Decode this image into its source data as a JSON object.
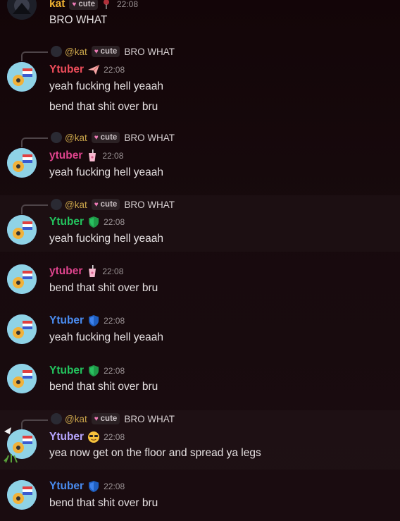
{
  "colors": {
    "kat": "#f0b232",
    "ytuber_red": "#f04d5b",
    "ytuber_pink": "#e0448e",
    "ytuber_green": "#23c45e",
    "ytuber_blue": "#4a8cf0",
    "ytuber_purple": "#b7a6ff"
  },
  "top_message": {
    "author": "kat",
    "tag": "cute",
    "time": "22:08",
    "text": "BRO WHAT"
  },
  "reply_preview": {
    "mention": "@kat",
    "tag": "cute",
    "text": "BRO WHAT"
  },
  "messages": [
    {
      "author": "Ytuber",
      "badge_icon": "paper-plane-icon",
      "time": "22:08",
      "lines": [
        "yeah fucking hell yeaah",
        "bend that shit over bru"
      ],
      "has_reply": true
    },
    {
      "author": "ytuber",
      "badge_icon": "milkshake-cup-icon",
      "time": "22:08",
      "lines": [
        "yeah fucking hell yeaah"
      ],
      "has_reply": true
    },
    {
      "author": "Ytuber",
      "badge_icon": "green-shield-icon",
      "time": "22:08",
      "lines": [
        "yeah fucking hell yeaah"
      ],
      "has_reply": true
    },
    {
      "author": "ytuber",
      "badge_icon": "milkshake-cup-icon",
      "time": "22:08",
      "lines": [
        "bend that shit over bru"
      ],
      "has_reply": false
    },
    {
      "author": "Ytuber",
      "badge_icon": "blue-shield-icon",
      "time": "22:08",
      "lines": [
        "yeah fucking hell yeaah"
      ],
      "has_reply": false
    },
    {
      "author": "Ytuber",
      "badge_icon": "green-shield-icon",
      "time": "22:08",
      "lines": [
        "bend that shit over bru"
      ],
      "has_reply": false
    },
    {
      "author": "Ytuber",
      "badge_icon": "sunglasses-emoji-icon",
      "time": "22:08",
      "lines": [
        "yea now get on the floor and spread ya legs"
      ],
      "has_reply": true
    },
    {
      "author": "Ytuber",
      "badge_icon": "blue-shield-icon",
      "time": "22:08",
      "lines": [
        "bend that shit over bru"
      ],
      "has_reply": false
    }
  ]
}
